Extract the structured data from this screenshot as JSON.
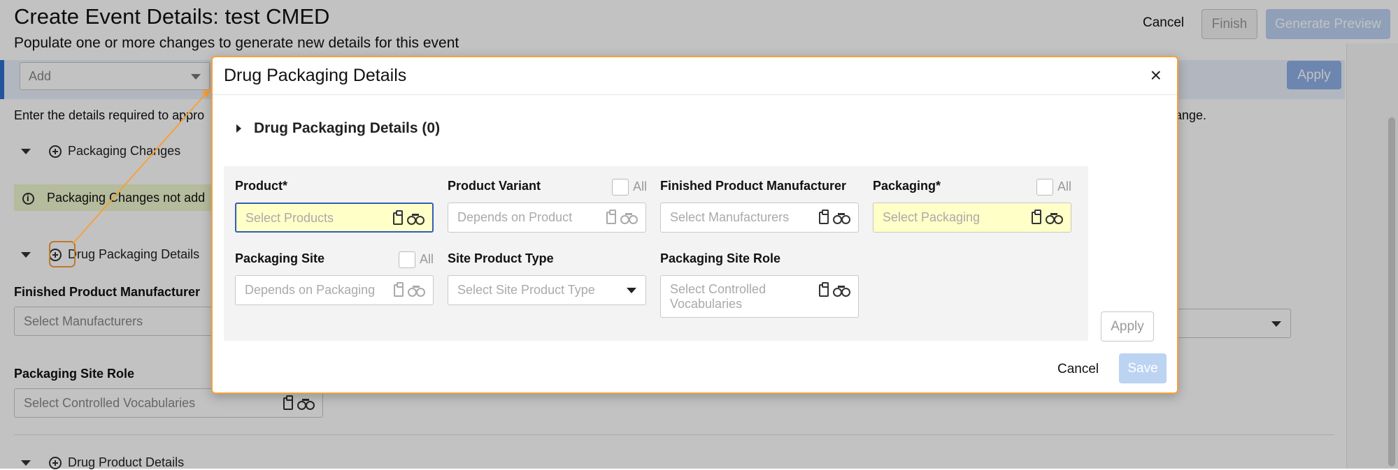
{
  "page": {
    "title": "Create Event Details: test CMED",
    "subtitle": "Populate one or more changes to generate new details for this event",
    "actions": {
      "cancel": "Cancel",
      "finish": "Finish",
      "generate_preview": "Generate Preview"
    },
    "add_select": {
      "placeholder": "Add"
    },
    "apply": "Apply",
    "instructions_start": "Enter the details required to appro",
    "instructions_end": "ange.",
    "sections": [
      {
        "label": "Packaging Changes"
      },
      {
        "label": "Drug Packaging Details"
      },
      {
        "label": "Drug Product Details"
      }
    ],
    "warning": "Packaging Changes not add",
    "fields": {
      "finished_product_manufacturer": {
        "label": "Finished Product Manufacturer",
        "placeholder": "Select Manufacturers"
      },
      "packaging_site_role": {
        "label": "Packaging Site Role",
        "placeholder": "Select Controlled Vocabularies"
      }
    }
  },
  "modal": {
    "title": "Drug Packaging Details",
    "close": "×",
    "details_toggle": "Drug Packaging Details (0)",
    "filters": {
      "product": {
        "label": "Product*",
        "placeholder": "Select Products"
      },
      "product_variant": {
        "label": "Product Variant",
        "all": "All",
        "placeholder": "Depends on Product"
      },
      "finished_product_manufacturer": {
        "label": "Finished Product Manufacturer",
        "placeholder": "Select Manufacturers"
      },
      "packaging": {
        "label": "Packaging*",
        "all": "All",
        "placeholder": "Select Packaging"
      },
      "packaging_site": {
        "label": "Packaging Site",
        "all": "All",
        "placeholder": "Depends on Packaging"
      },
      "site_product_type": {
        "label": "Site Product Type",
        "placeholder": "Select Site Product Type"
      },
      "packaging_site_role": {
        "label": "Packaging Site Role",
        "placeholder": "Select Controlled Vocabularies"
      }
    },
    "apply": "Apply",
    "cancel": "Cancel",
    "save": "Save"
  },
  "colors": {
    "accent": "#2f6fcf",
    "highlight": "#f5a13c",
    "primary_disabled": "#bcd3f2",
    "required_field": "#ffffc8",
    "warning_bg": "#eef6cf"
  }
}
